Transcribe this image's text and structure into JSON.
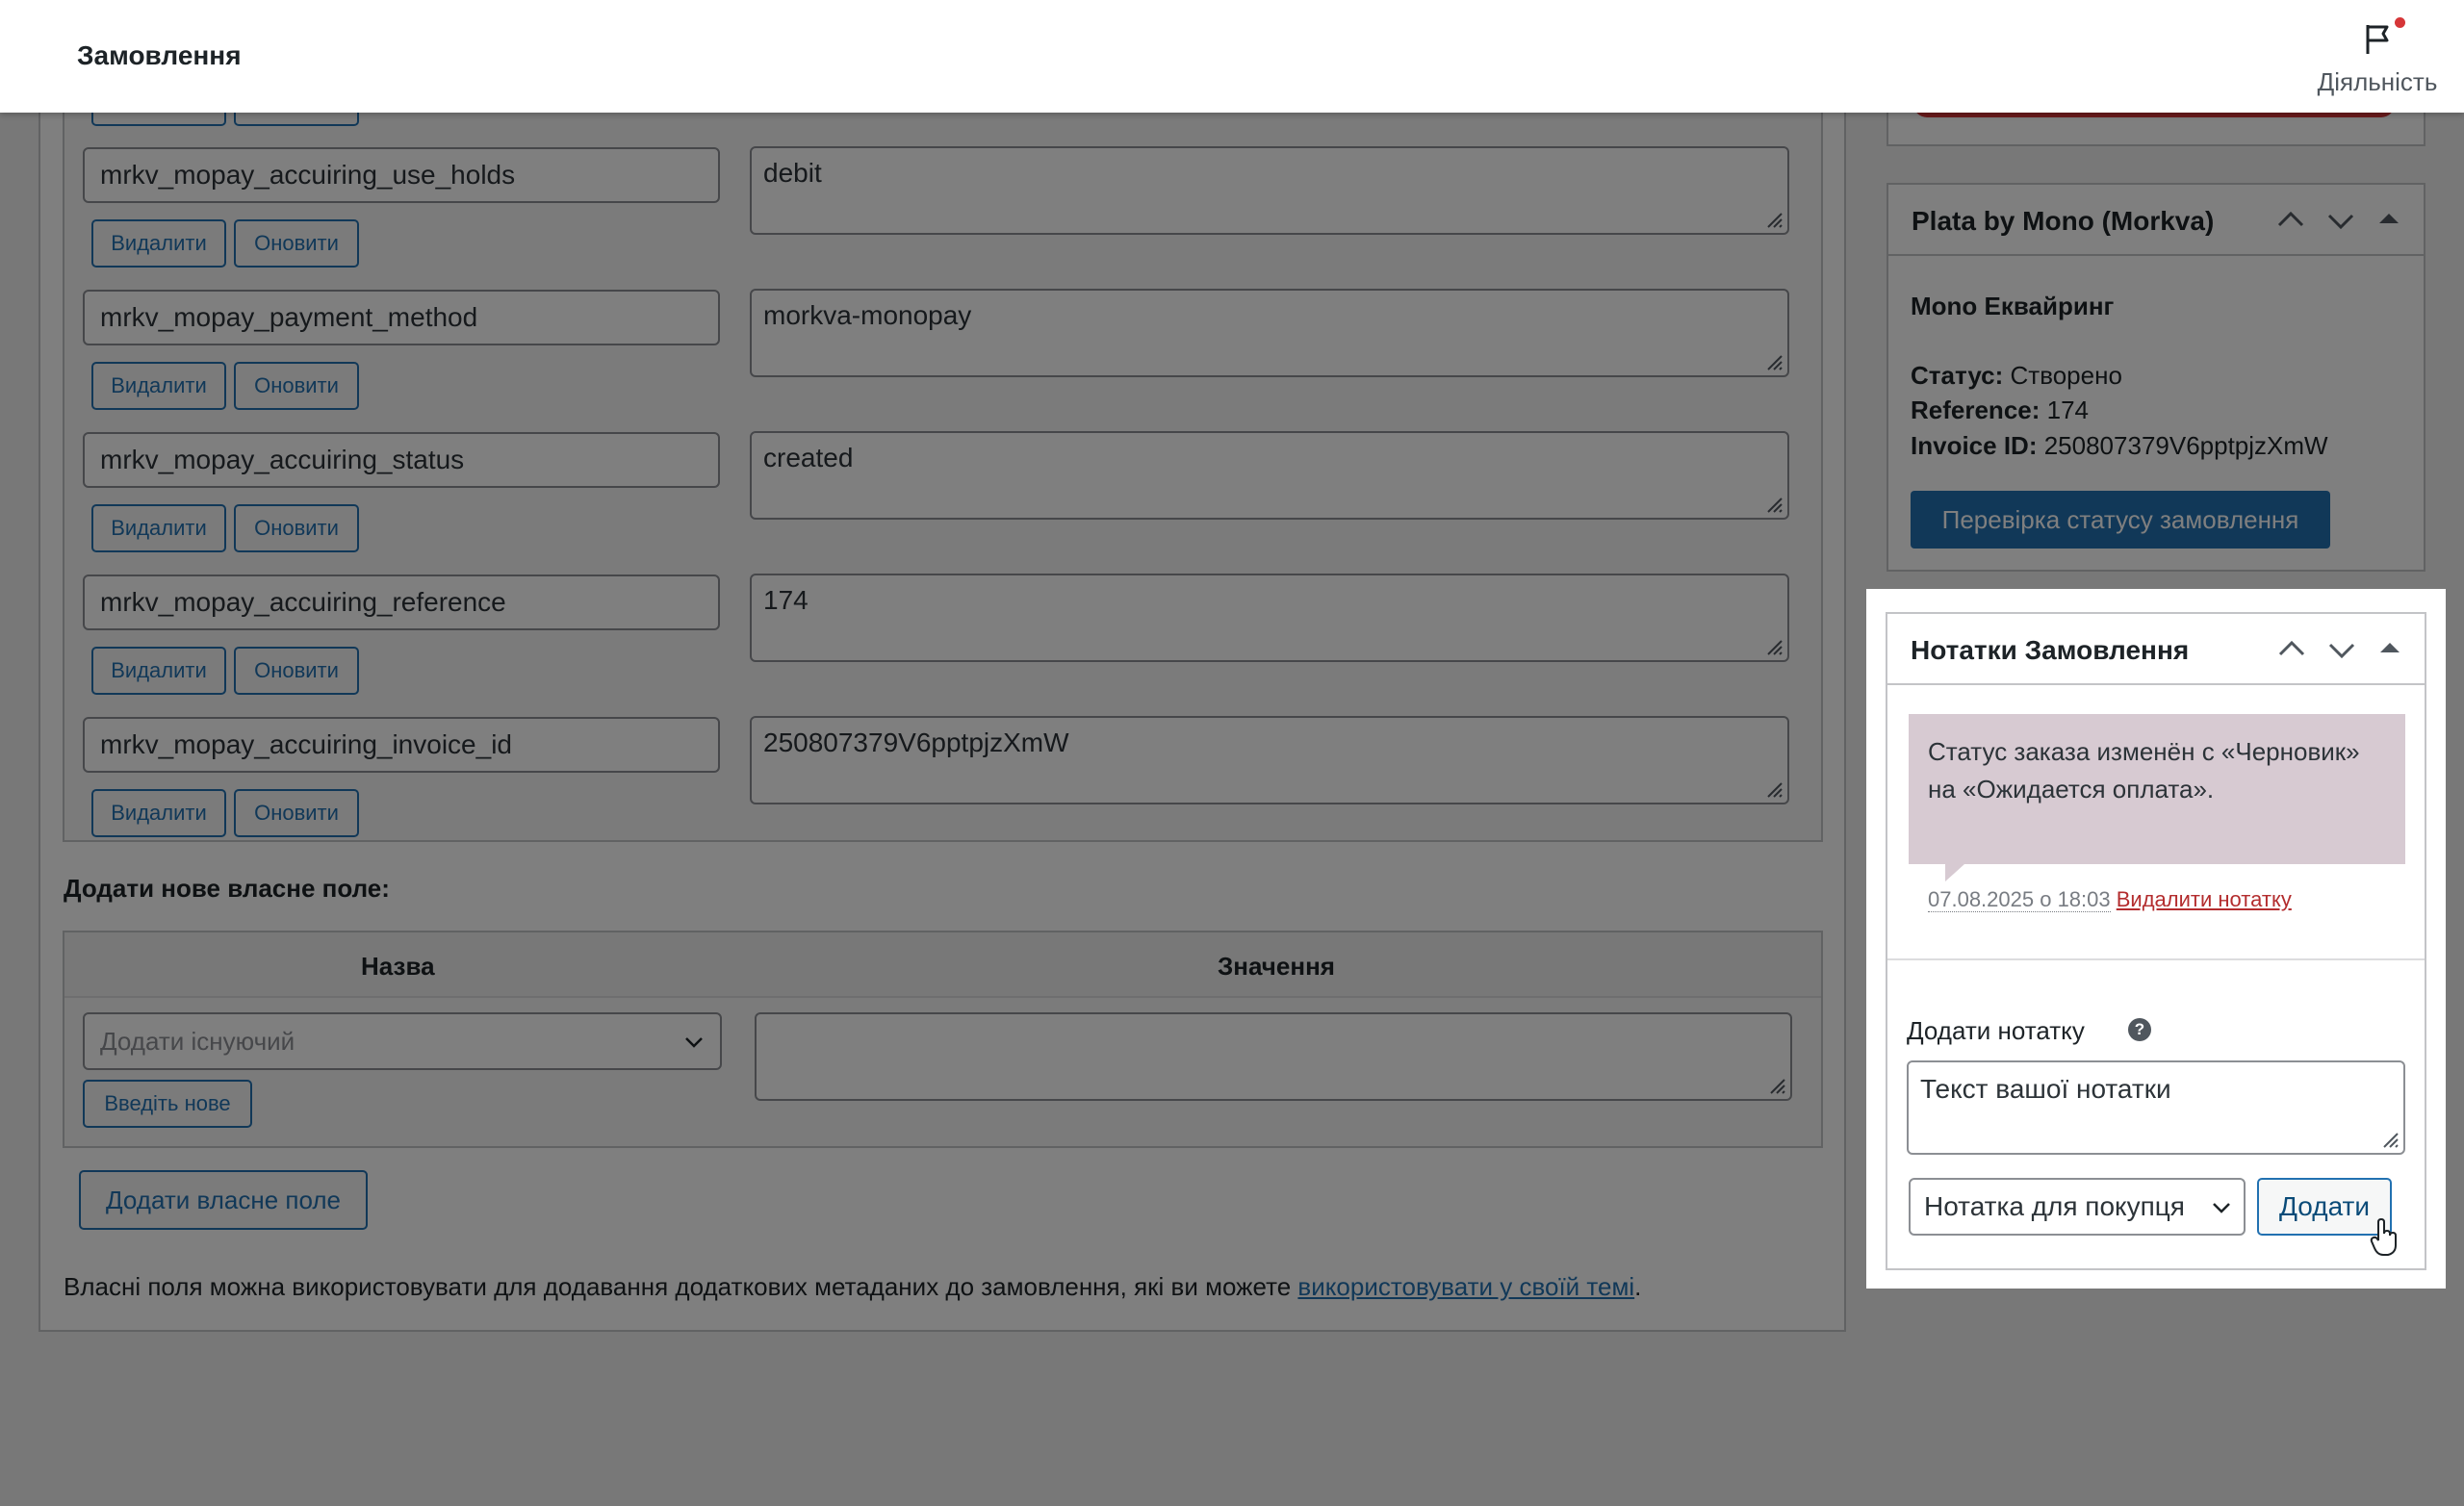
{
  "header": {
    "title": "Замовлення",
    "activity_label": "Діяльність"
  },
  "custom_fields": {
    "rows": [
      {
        "key": "mrkv_mopay_accuiring_use_holds",
        "value": "debit"
      },
      {
        "key": "mrkv_mopay_payment_method",
        "value": "morkva-monopay"
      },
      {
        "key": "mrkv_mopay_accuiring_status",
        "value": "created"
      },
      {
        "key": "mrkv_mopay_accuiring_reference",
        "value": "174"
      },
      {
        "key": "mrkv_mopay_accuiring_invoice_id",
        "value": "250807379V6pptpjzXmW"
      }
    ],
    "delete_label": "Видалити",
    "update_label": "Оновити",
    "add_new_title": "Додати нове власне поле:",
    "col_name": "Назва",
    "col_value": "Значення",
    "select_existing_placeholder": "Додати існуючий",
    "enter_new_label": "Введіть нове",
    "add_custom_field_label": "Додати власне поле",
    "help_text": "Власні поля можна використовувати для додавання додаткових метаданих до замовлення, які ви можете ",
    "help_link": "використовувати у своїй темі",
    "help_end": "."
  },
  "plata_box": {
    "title": "Plata by Mono (Morkva)",
    "subtitle": "Mono Еквайринг",
    "status_label": "Статус:",
    "status_value": "Створено",
    "reference_label": "Reference:",
    "reference_value": "174",
    "invoice_label": "Invoice ID:",
    "invoice_value": "250807379V6pptpjzXmW",
    "check_button": "Перевірка статусу замовлення"
  },
  "notes_box": {
    "title": "Нотатки Замовлення",
    "note_text": "Статус заказа изменён с «Черновик» на «Ожидается оплата».",
    "note_date": "07.08.2025 о 18:03",
    "note_delete": "Видалити нотатку",
    "add_note_label": "Додати нотатку",
    "help_icon": "?",
    "note_placeholder": "Текст вашої нотатки",
    "note_type_selected": "Нотатка для покупця",
    "add_button": "Додати"
  },
  "colors": {
    "accent": "#2271b1",
    "note_bg": "#d7cad2",
    "danger": "#d63638"
  }
}
